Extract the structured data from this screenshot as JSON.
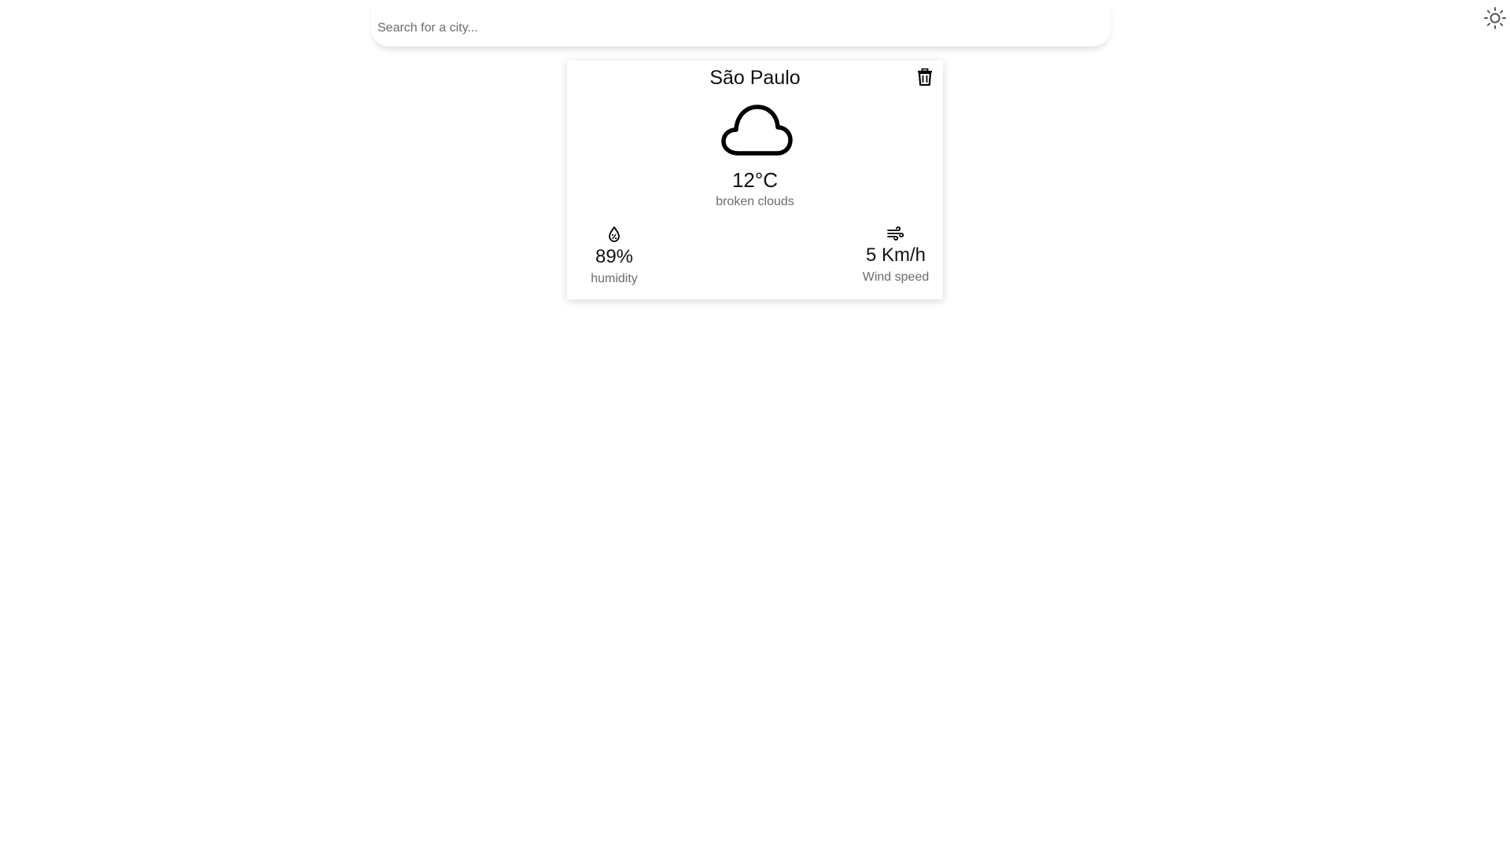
{
  "search": {
    "placeholder": "Search for a city...",
    "value": ""
  },
  "header": {
    "theme_toggle_icon": "sun-icon"
  },
  "card": {
    "city": "São Paulo",
    "delete_icon": "trash-icon",
    "weather_icon": "cloud-icon",
    "temperature": "12°C",
    "description": "broken clouds",
    "humidity": {
      "icon": "humidity-drop-icon",
      "value": "89%",
      "label": "humidity"
    },
    "wind": {
      "icon": "wind-icon",
      "value": "5 Km/h",
      "label": "Wind speed"
    }
  },
  "colors": {
    "background": "#ffffff",
    "primary_text": "#111111",
    "secondary_text": "#6b6b6b",
    "icon": "#000000",
    "theme_icon": "#555555"
  }
}
